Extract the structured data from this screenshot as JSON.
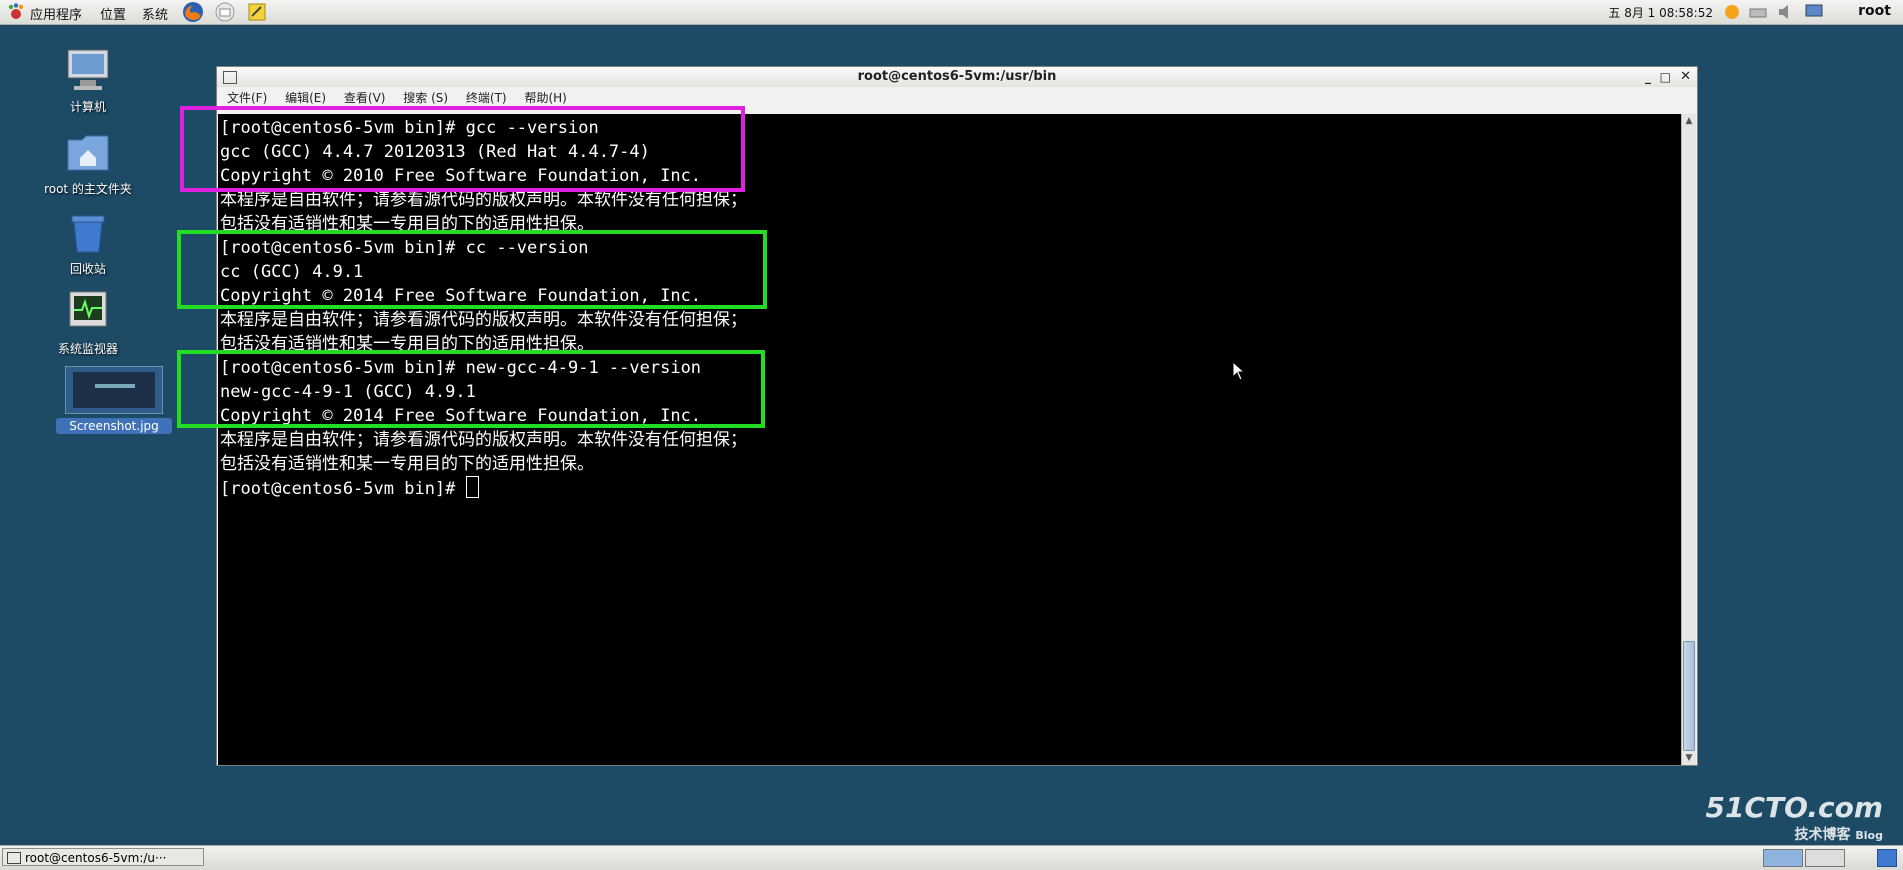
{
  "top_panel": {
    "menus": [
      "应用程序",
      "位置",
      "系统"
    ],
    "clock": "五 8月  1 08:58:52",
    "user": "root"
  },
  "desktop": {
    "icons": [
      {
        "label": "计算机"
      },
      {
        "label": "root 的主文件夹"
      },
      {
        "label": "回收站"
      },
      {
        "label": "系统监视器"
      },
      {
        "label": "Screenshot.jpg"
      }
    ]
  },
  "window": {
    "title": "root@centos6-5vm:/usr/bin",
    "menu": [
      "文件(F)",
      "编辑(E)",
      "查看(V)",
      "搜索 (S)",
      "终端(T)",
      "帮助(H)"
    ]
  },
  "terminal": {
    "lines": [
      "[root@centos6-5vm bin]# gcc --version",
      "gcc (GCC) 4.4.7 20120313 (Red Hat 4.4.7-4)",
      "Copyright © 2010 Free Software Foundation, Inc.",
      "本程序是自由软件；请参看源代码的版权声明。本软件没有任何担保；",
      "包括没有适销性和某一专用目的下的适用性担保。",
      "[root@centos6-5vm bin]# cc --version",
      "cc (GCC) 4.9.1",
      "Copyright © 2014 Free Software Foundation, Inc.",
      "本程序是自由软件；请参看源代码的版权声明。本软件没有任何担保；",
      "包括没有适销性和某一专用目的下的适用性担保。",
      "[root@centos6-5vm bin]# new-gcc-4-9-1 --version",
      "new-gcc-4-9-1 (GCC) 4.9.1",
      "Copyright © 2014 Free Software Foundation, Inc.",
      "本程序是自由软件；请参看源代码的版权声明。本软件没有任何担保；",
      "包括没有适销性和某一专用目的下的适用性担保。",
      "[root@centos6-5vm bin]# "
    ]
  },
  "highlight_colors": {
    "magenta": "#e020e0",
    "green": "#22dd22"
  },
  "taskbar": {
    "item": "root@centos6-5vm:/u···"
  },
  "watermark": {
    "main": "51CTO.com",
    "sub": "技术博客",
    "blog": "Blog"
  }
}
